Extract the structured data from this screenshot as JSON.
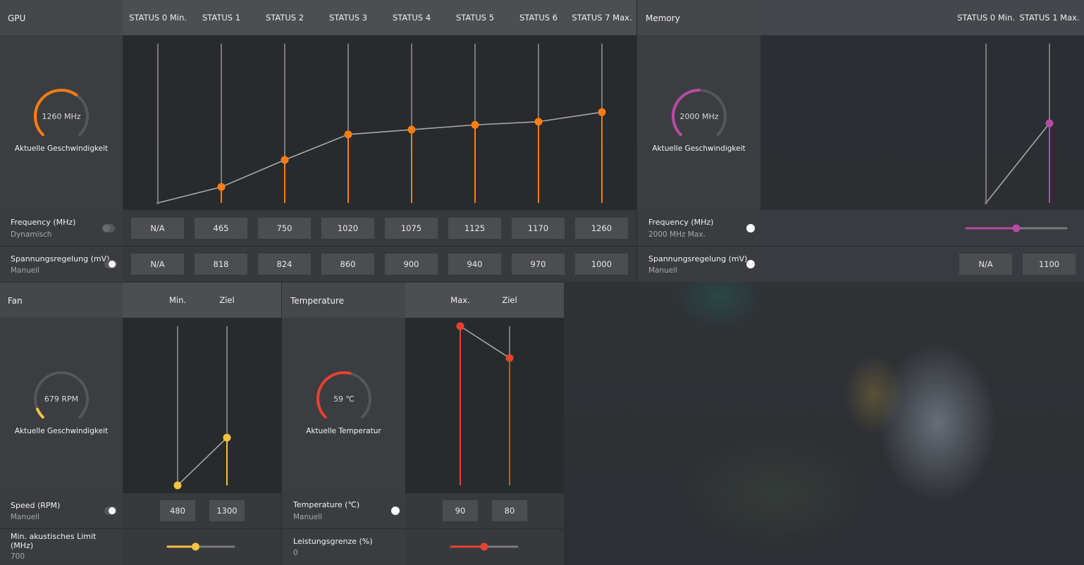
{
  "colors": {
    "gpu_accent": "#ff7d0f",
    "memory_accent": "#b84aa6",
    "fan_accent": "#f5c242",
    "temp_accent": "#e8412f",
    "track": "#9a9a9a"
  },
  "gpu": {
    "title": "GPU",
    "states": [
      "STATUS 0 Min.",
      "STATUS 1",
      "STATUS 2",
      "STATUS 3",
      "STATUS 4",
      "STATUS 5",
      "STATUS 6",
      "STATUS 7 Max."
    ],
    "gauge_value": "1260 MHz",
    "gauge_fraction": 0.63,
    "gauge_caption": "Aktuelle Geschwindigkeit",
    "frequency_label": "Frequency (MHz)",
    "frequency_mode": "Dynamisch",
    "frequency_values": [
      "N/A",
      "465",
      "750",
      "1020",
      "1075",
      "1125",
      "1170",
      "1260"
    ],
    "voltage_label": "Spannungsregelung (mV)",
    "voltage_mode": "Manuell",
    "voltage_values": [
      "N/A",
      "818",
      "824",
      "860",
      "900",
      "940",
      "970",
      "1000"
    ],
    "curve_levels": [
      0,
      0.1,
      0.27,
      0.43,
      0.46,
      0.49,
      0.51,
      0.57
    ]
  },
  "memory": {
    "title": "Memory",
    "states": [
      "STATUS 0 Min.",
      "STATUS 1 Max."
    ],
    "gauge_value": "2000 MHz",
    "gauge_fraction": 0.5,
    "gauge_caption": "Aktuelle Geschwindigkeit",
    "frequency_label": "Frequency (MHz)",
    "frequency_mode": "2000 MHz Max.",
    "frequency_slider": 0.5,
    "voltage_label": "Spannungsregelung (mV)",
    "voltage_mode": "Manuell",
    "voltage_values": [
      "N/A",
      "1100"
    ],
    "curve_levels": [
      0,
      0.5
    ]
  },
  "fan": {
    "title": "Fan",
    "columns": [
      "Min.",
      "Ziel"
    ],
    "gauge_value": "679 RPM",
    "gauge_fraction": 0.08,
    "gauge_caption": "Aktuelle Geschwindigkeit",
    "speed_label": "Speed (RPM)",
    "speed_mode": "Manuell",
    "speed_values": [
      "480",
      "1300"
    ],
    "acoustic_label_line1": "Min. akustisches Limit",
    "acoustic_label_line2": "(MHz)",
    "acoustic_value": "700",
    "acoustic_slider": 0.42,
    "curve_levels": [
      0,
      0.3
    ]
  },
  "temperature": {
    "title": "Temperature",
    "columns": [
      "Max.",
      "Ziel"
    ],
    "gauge_value": "59 ℃",
    "gauge_fraction": 0.55,
    "gauge_caption": "Aktuelle Temperatur",
    "temp_label": "Temperature (℃)",
    "temp_mode": "Manuell",
    "temp_values": [
      "90",
      "80"
    ],
    "power_label": "Leistungsgrenze (%)",
    "power_value": "0",
    "power_slider": 0.5,
    "curve_levels": [
      1.0,
      0.8
    ]
  }
}
